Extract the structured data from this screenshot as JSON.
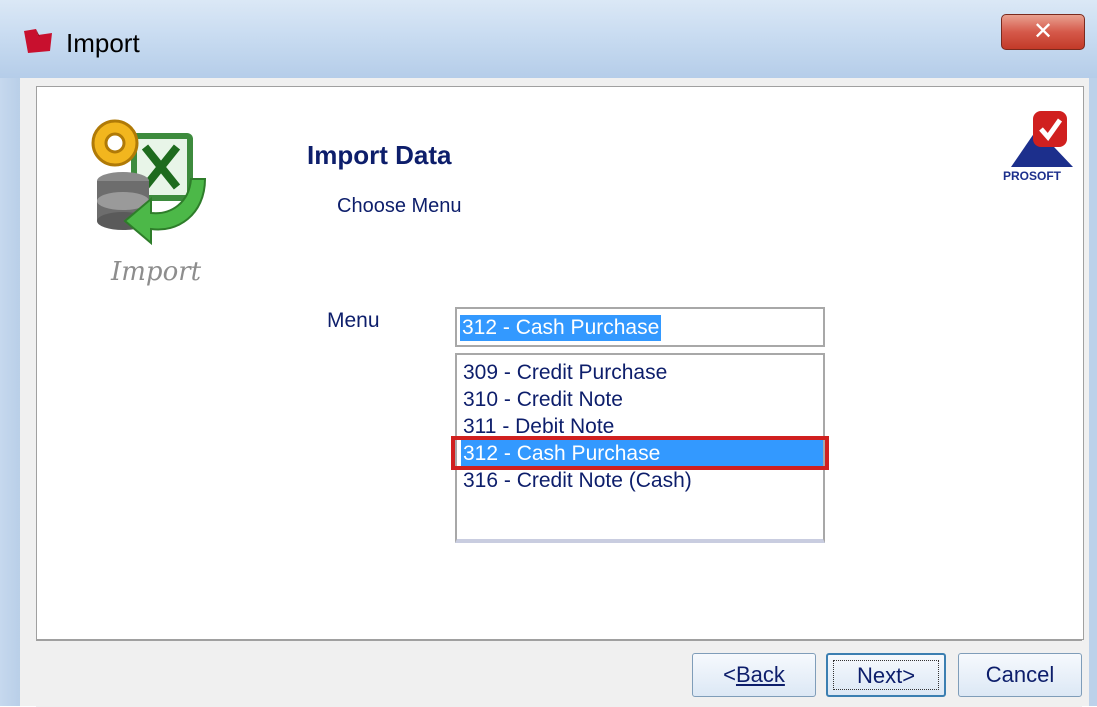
{
  "window": {
    "title": "Import",
    "close_glyph": "✕"
  },
  "branding": {
    "import_logo_label": "Import",
    "vendor_logo_text": "PROSOFT"
  },
  "header": {
    "title": "Import Data",
    "subtitle": "Choose Menu"
  },
  "form": {
    "menu_label": "Menu",
    "menu_value": "312 - Cash Purchase",
    "options": [
      {
        "label": "309 - Credit Purchase",
        "selected": false
      },
      {
        "label": "310 - Credit Note",
        "selected": false
      },
      {
        "label": "311 - Debit Note",
        "selected": false
      },
      {
        "label": "312 - Cash Purchase",
        "selected": true
      },
      {
        "label": "316 - Credit Note (Cash)",
        "selected": false
      }
    ]
  },
  "buttons": {
    "back": "Back",
    "back_prefix": "<",
    "next": "Next>",
    "cancel": "Cancel"
  },
  "colors": {
    "selection": "#3399ff",
    "highlight_box": "#d0201f",
    "heading": "#0d1e6b"
  }
}
